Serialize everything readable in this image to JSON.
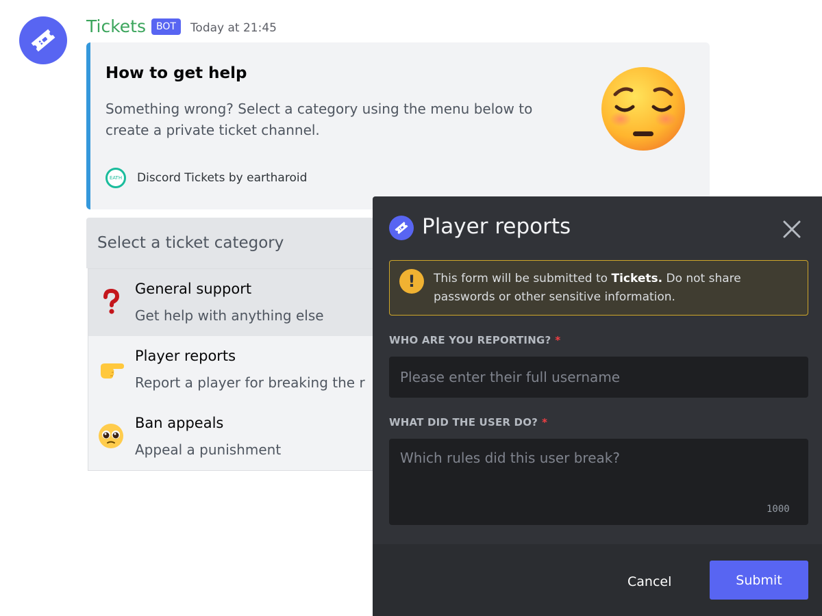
{
  "message": {
    "author": "Tickets",
    "bot_tag": "BOT",
    "timestamp": "Today at 21:45",
    "avatar_icon": "ticket-icon"
  },
  "embed": {
    "accent_color": "#3498db",
    "title": "How to get help",
    "description": "Something wrong? Select a category using the menu below to create a private ticket channel.",
    "thumbnail": "pensive-face-emoji",
    "footer_icon_text": "EATH",
    "footer_text": "Discord Tickets by eartharoid"
  },
  "select_menu": {
    "placeholder": "Select a ticket category",
    "options": [
      {
        "emoji": "question-mark-emoji",
        "label": "General support",
        "description": "Get help with anything else"
      },
      {
        "emoji": "pointing-hand-emoji",
        "label": "Player reports",
        "description": "Report a player for breaking the r"
      },
      {
        "emoji": "pleading-face-emoji",
        "label": "Ban appeals",
        "description": "Appeal a punishment"
      }
    ]
  },
  "modal": {
    "title": "Player reports",
    "warning_prefix": "This form will be submitted to ",
    "warning_bold": "Tickets.",
    "warning_suffix": " Do not share passwords or other sensitive information.",
    "fields": [
      {
        "label": "WHO ARE YOU REPORTING?",
        "required_mark": "*",
        "placeholder": "Please enter their full username",
        "value": ""
      },
      {
        "label": "WHAT DID THE USER DO?",
        "required_mark": "*",
        "placeholder": "Which rules did this user break?",
        "value": "",
        "max_length": "1000"
      }
    ],
    "cancel_label": "Cancel",
    "submit_label": "Submit"
  },
  "colors": {
    "brand": "#5865f2",
    "author_green": "#3ba55c",
    "warning_border": "#cfa72a",
    "required_red": "#f23f43"
  }
}
